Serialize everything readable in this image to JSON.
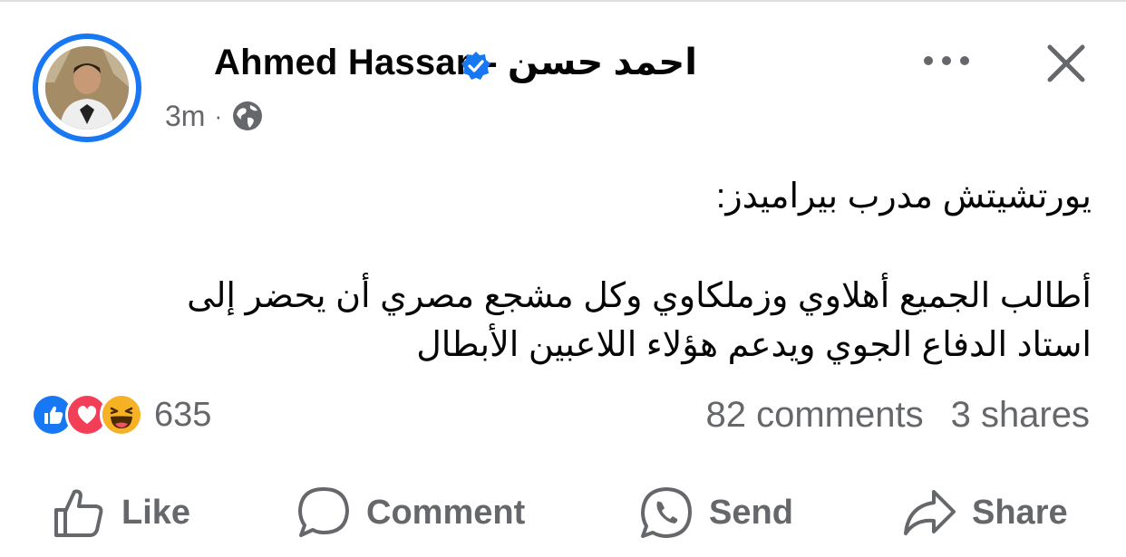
{
  "post": {
    "author": {
      "name_latin": "Ahmed Hassan",
      "name_separator_arabic": "- احمد حسن",
      "verified": true
    },
    "time": "3m",
    "meta_separator": "·",
    "audience_icon": "globe-icon",
    "text_lines": [
      "يورتشيتش مدرب بيراميدز:",
      "أطالب الجميع أهلاوي وزملكاوي وكل مشجع مصري أن يحضر إلى",
      "استاد الدفاع الجوي ويدعم هؤلاء اللاعبين الأبطال"
    ],
    "reactions": {
      "icons": [
        "like-reaction-icon",
        "love-reaction-icon",
        "haha-reaction-icon"
      ],
      "count": "635"
    },
    "comments": "82 comments",
    "shares": "3 shares"
  },
  "actions": {
    "like": "Like",
    "comment": "Comment",
    "send": "Send",
    "share": "Share"
  },
  "colors": {
    "accent": "#1877f2",
    "secondary_text": "#65676b",
    "love": "#f33e58",
    "haha": "#f7b125"
  }
}
